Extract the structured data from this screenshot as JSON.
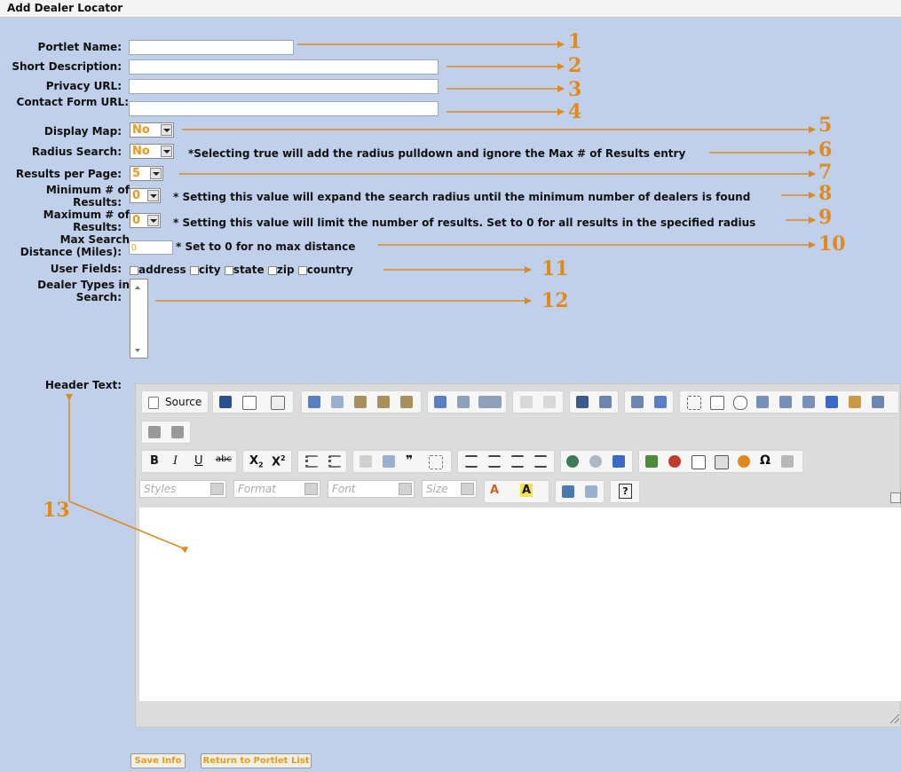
{
  "title": "Add Dealer Locator",
  "form": {
    "portlet_name": {
      "label": "Portlet Name:",
      "value": ""
    },
    "short_description": {
      "label": "Short Description:",
      "value": ""
    },
    "privacy_url": {
      "label": "Privacy URL:",
      "value": ""
    },
    "contact_form_url": {
      "label": "Contact Form URL:",
      "value": ""
    },
    "display_map": {
      "label": "Display Map:",
      "value": "No"
    },
    "radius_search": {
      "label": "Radius Search:",
      "value": "No",
      "note": "*Selecting true will add the radius pulldown and ignore the Max # of Results entry"
    },
    "results_per_page": {
      "label": "Results per Page:",
      "value": "5"
    },
    "minimum_results": {
      "label_line1": "Minimum # of",
      "label_line2": "Results:",
      "value": "0",
      "note": "* Setting this value will expand the search radius until the minimum number of dealers is found"
    },
    "maximum_results": {
      "label_line1": "Maximum # of",
      "label_line2": "Results:",
      "value": "0",
      "note": "* Setting this value will limit the number of results. Set to 0 for all results in the specified radius"
    },
    "max_search_distance": {
      "label_line1": "Max Search",
      "label_line2": "Distance (Miles):",
      "value": "0",
      "note": "* Set to 0 for no max distance"
    },
    "user_fields": {
      "label": "User Fields:",
      "options": [
        "address",
        "city",
        "state",
        "zip",
        "country"
      ]
    },
    "dealer_types": {
      "label_line1": "Dealer Types in",
      "label_line2": "Search:"
    },
    "header_text": {
      "label": "Header Text:"
    }
  },
  "editor": {
    "source_label": "Source",
    "styles_placeholder": "Styles",
    "format_placeholder": "Format",
    "font_placeholder": "Font",
    "size_placeholder": "Size"
  },
  "buttons": {
    "save": "Save Info",
    "return": "Return to Portlet List"
  },
  "callouts": [
    "1",
    "2",
    "3",
    "4",
    "5",
    "6",
    "7",
    "8",
    "9",
    "10",
    "11",
    "12",
    "13"
  ],
  "colors": {
    "background": "#c0d0ea",
    "annotation": "#e08a1e"
  }
}
